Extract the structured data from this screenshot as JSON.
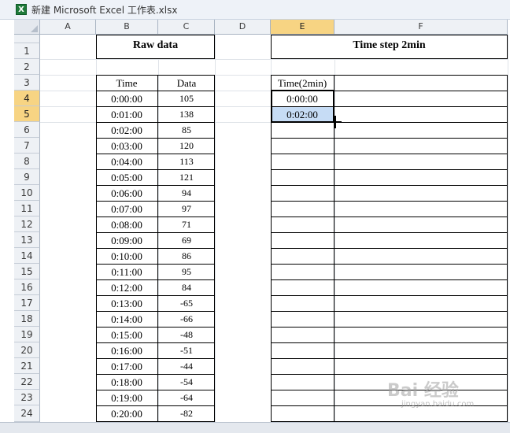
{
  "window": {
    "title": "新建 Microsoft Excel 工作表.xlsx"
  },
  "columns": [
    "A",
    "B",
    "C",
    "D",
    "E",
    "F"
  ],
  "rows": [
    "1",
    "2",
    "3",
    "4",
    "5",
    "6",
    "7",
    "8",
    "9",
    "10",
    "11",
    "12",
    "13",
    "14",
    "15",
    "16",
    "17",
    "18",
    "19",
    "20",
    "21",
    "22",
    "23",
    "24"
  ],
  "raw_data": {
    "title": "Raw data",
    "time_header": "Time",
    "data_header": "Data",
    "times": [
      "0:00:00",
      "0:01:00",
      "0:02:00",
      "0:03:00",
      "0:04:00",
      "0:05:00",
      "0:06:00",
      "0:07:00",
      "0:08:00",
      "0:09:00",
      "0:10:00",
      "0:11:00",
      "0:12:00",
      "0:13:00",
      "0:14:00",
      "0:15:00",
      "0:16:00",
      "0:17:00",
      "0:18:00",
      "0:19:00",
      "0:20:00"
    ],
    "values": [
      "105",
      "138",
      "85",
      "120",
      "113",
      "121",
      "94",
      "97",
      "71",
      "69",
      "86",
      "95",
      "84",
      "-65",
      "-66",
      "-48",
      "-51",
      "-44",
      "-54",
      "-64",
      "-82"
    ]
  },
  "time_step": {
    "title": "Time step 2min",
    "header": "Time(2min)",
    "values": [
      "0:00:00",
      "0:02:00"
    ]
  },
  "watermark": {
    "main": "Bai 经验",
    "sub": "jingyan.baidu.com"
  },
  "colors": {
    "selected_header": "#f7d483",
    "fill_selection": "#c6dcf5"
  }
}
